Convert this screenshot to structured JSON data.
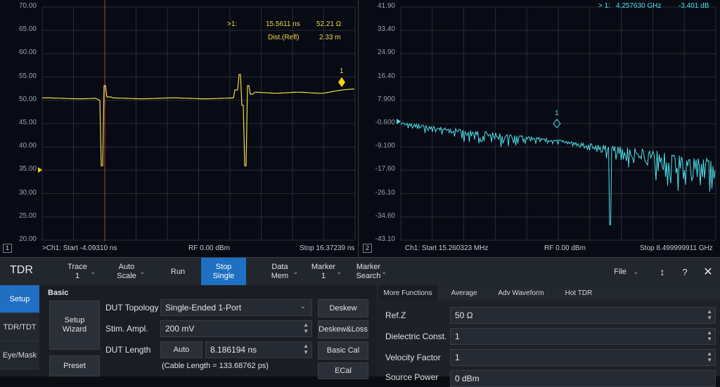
{
  "left_plot": {
    "y_ticks": [
      "70.00",
      "65.00",
      "60.00",
      "55.00",
      "50.00",
      "45.00",
      "40.00",
      "35.00",
      "30.00",
      "25.00",
      "20.00"
    ],
    "marker_readout": {
      "id": ">1:",
      "time": "15.5611 ns",
      "value": "52.21 Ω",
      "dist_label": "Dist.(Refl)",
      "dist_value": "2.33 m"
    },
    "marker_label": "1",
    "footer_start": ">Ch1: Start -4.09310 ns",
    "footer_center": "RF 0.00 dBm",
    "footer_stop": "Stop 16.37239 ns",
    "trace_number": "1",
    "trace_color": "#f0d94a",
    "marker_color": "#f5d40c",
    "cursor_color": "#b6442c"
  },
  "right_plot": {
    "y_ticks": [
      "41.90",
      "33.40",
      "24.90",
      "16.40",
      "7.900",
      "-0.600",
      "-9.100",
      "-17.60",
      "-26.10",
      "-34.60",
      "-43.10"
    ],
    "marker_readout": {
      "id": "> 1:",
      "freq": "4.257630 GHz",
      "value": "-3.401 dB"
    },
    "marker_label": "1",
    "footer_start": "Ch1: Start 15.260323 MHz",
    "footer_center": "RF 0.00 dBm",
    "footer_stop": "Stop 8.499999911 GHz",
    "trace_number": "2",
    "trace_color": "#4fe0e6"
  },
  "toolbar": {
    "title": "TDR",
    "trace": {
      "label": "Trace",
      "value": "1"
    },
    "auto_scale": {
      "line1": "Auto",
      "line2": "Scale"
    },
    "run": "Run",
    "stop_single": {
      "line1": "Stop",
      "line2": "Single"
    },
    "data_mem": {
      "line1": "Data",
      "line2": "Mem"
    },
    "marker": {
      "label": "Marker",
      "value": "1"
    },
    "marker_search": {
      "line1": "Marker",
      "line2": "Search"
    },
    "file": "File",
    "accent_color": "#1f6fc2"
  },
  "side_tabs": [
    "Setup",
    "TDR/TDT",
    "Eye/Mask"
  ],
  "basic": {
    "heading": "Basic",
    "setup_wizard": {
      "line1": "Setup",
      "line2": "Wizard"
    },
    "preset": "Preset",
    "dut_topology_label": "DUT Topology",
    "dut_topology_value": "Single-Ended 1-Port",
    "stim_ampl_label": "Stim. Ampl.",
    "stim_ampl_value": "200 mV",
    "dut_length_label": "DUT Length",
    "auto_button": "Auto",
    "dut_length_value": "8.186194 ns",
    "cable_length": "(Cable Length = 133.68762 ps)",
    "deskew": "Deskew",
    "deskew_loss": "Deskew&Loss",
    "basic_cal": "Basic Cal",
    "ecal": "ECal"
  },
  "right_panel": {
    "tabs": [
      "More Functions",
      "Average",
      "Adv Waveform",
      "Hot TDR"
    ],
    "refz_label": "Ref.Z",
    "refz_value": "50 Ω",
    "dielectric_label": "Dielectric Const.",
    "dielectric_value": "1",
    "velocity_label": "Velocity Factor",
    "velocity_value": "1",
    "source_power_label": "Source Power",
    "source_power_value": "0 dBm"
  }
}
